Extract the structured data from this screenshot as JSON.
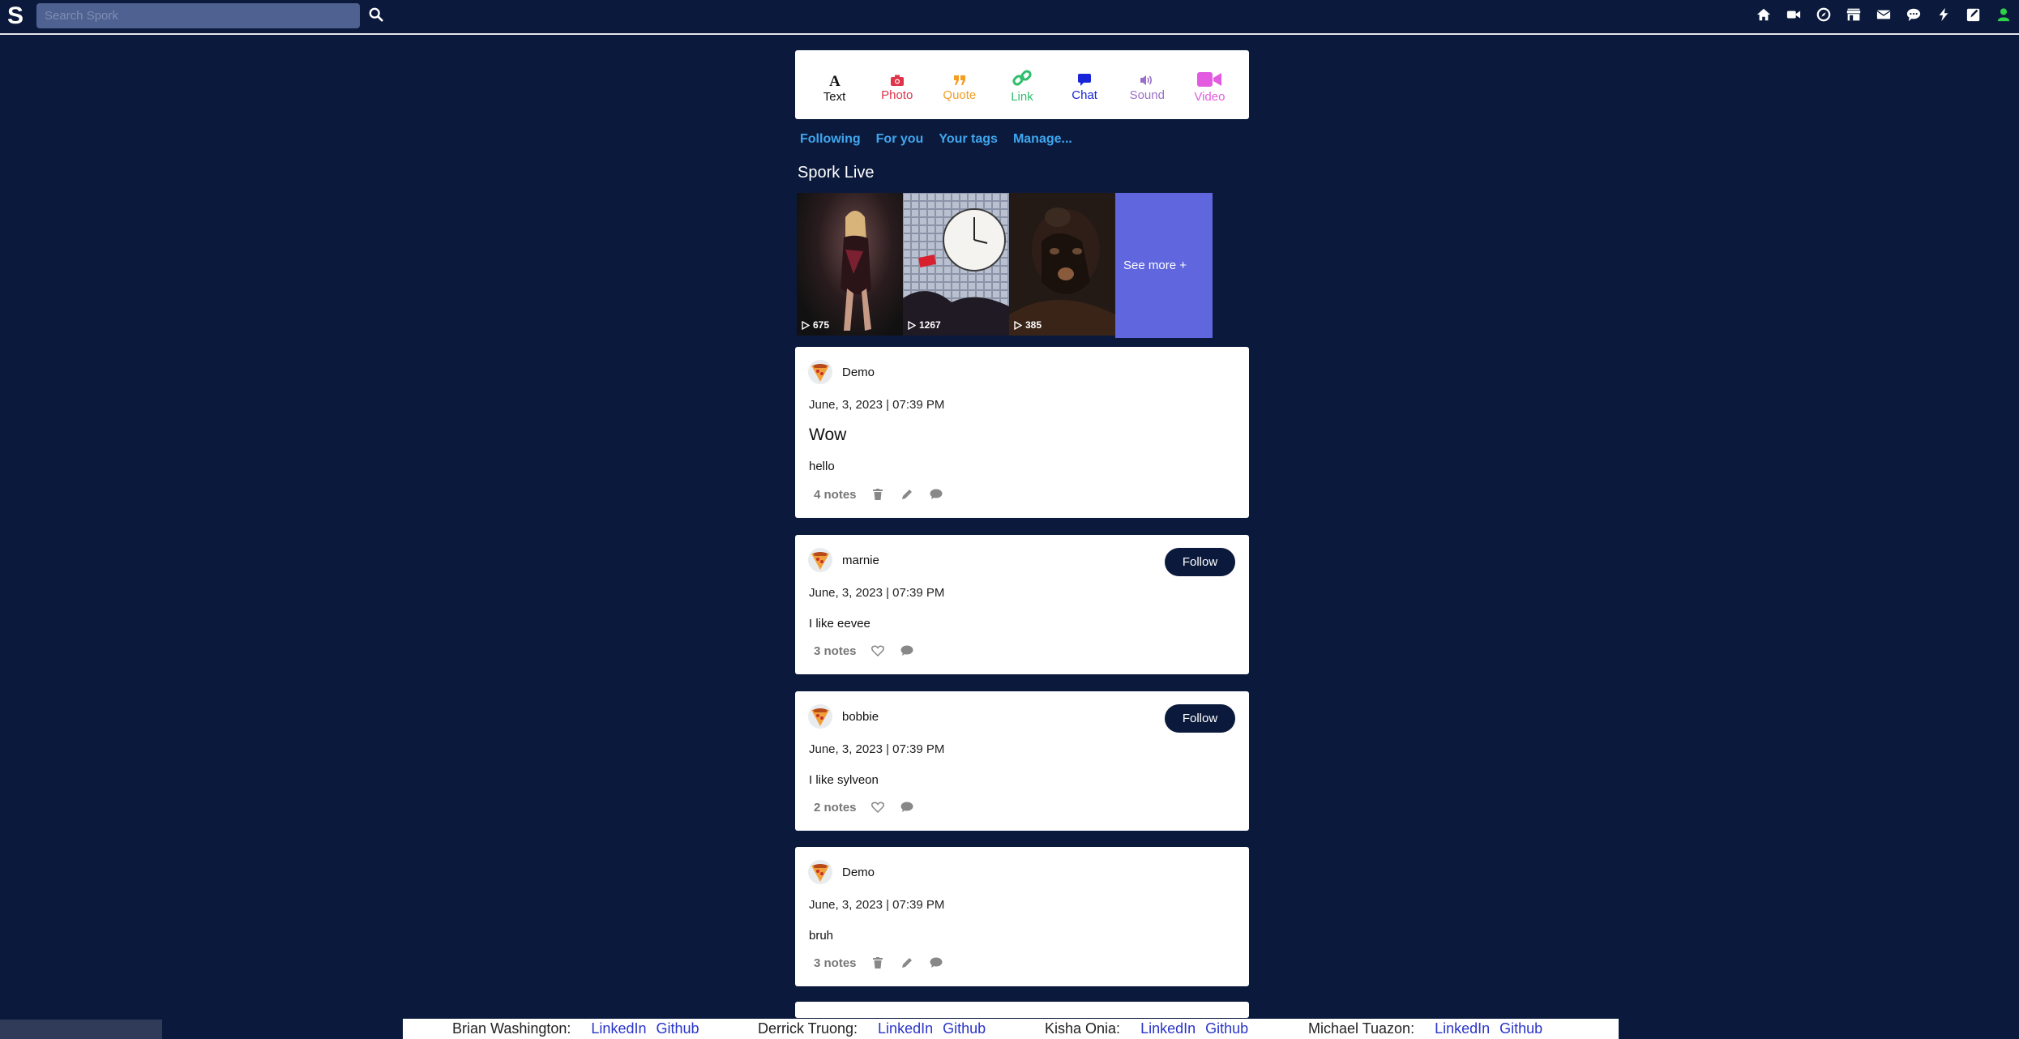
{
  "app": {
    "logo": "S"
  },
  "search": {
    "placeholder": "Search Spork"
  },
  "nav": {
    "icons": [
      "home-icon",
      "video-camera-icon",
      "compass-icon",
      "store-icon",
      "mail-icon",
      "chat-bubble-icon",
      "lightning-icon",
      "edit-icon",
      "user-icon"
    ]
  },
  "post_types": [
    {
      "label": "Text",
      "color": "#111111"
    },
    {
      "label": "Photo",
      "color": "#e0344a"
    },
    {
      "label": "Quote",
      "color": "#f29e25"
    },
    {
      "label": "Link",
      "color": "#2fbe6b"
    },
    {
      "label": "Chat",
      "color": "#1825d8"
    },
    {
      "label": "Sound",
      "color": "#9a6fc8"
    },
    {
      "label": "Video",
      "color": "#e25be0"
    }
  ],
  "tabs": [
    "Following",
    "For you",
    "Your tags",
    "Manage..."
  ],
  "live": {
    "title": "Spork Live",
    "videos": [
      {
        "views": "675"
      },
      {
        "views": "1267"
      },
      {
        "views": "385"
      }
    ],
    "see_more": "See more +"
  },
  "posts": [
    {
      "author": "Demo",
      "date": "June, 3, 2023 | 07:39 PM",
      "title": "Wow",
      "body": "hello",
      "notes": "4 notes"
    },
    {
      "author": "marnie",
      "date": "June, 3, 2023 | 07:39 PM",
      "body": "I like eevee",
      "notes": "3 notes",
      "follow": "Follow"
    },
    {
      "author": "bobbie",
      "date": "June, 3, 2023 | 07:39 PM",
      "body": "I like sylveon",
      "notes": "2 notes",
      "follow": "Follow"
    },
    {
      "author": "Demo",
      "date": "June, 3, 2023 | 07:39 PM",
      "body": "bruh",
      "notes": "3 notes"
    }
  ],
  "footer": [
    {
      "name": "Brian Washington:",
      "linkedin": "LinkedIn",
      "github": "Github"
    },
    {
      "name": "Derrick Truong:",
      "linkedin": "LinkedIn",
      "github": "Github"
    },
    {
      "name": "Kisha Onia:",
      "linkedin": "LinkedIn",
      "github": "Github"
    },
    {
      "name": "Michael Tuazon:",
      "linkedin": "LinkedIn",
      "github": "Github"
    }
  ]
}
